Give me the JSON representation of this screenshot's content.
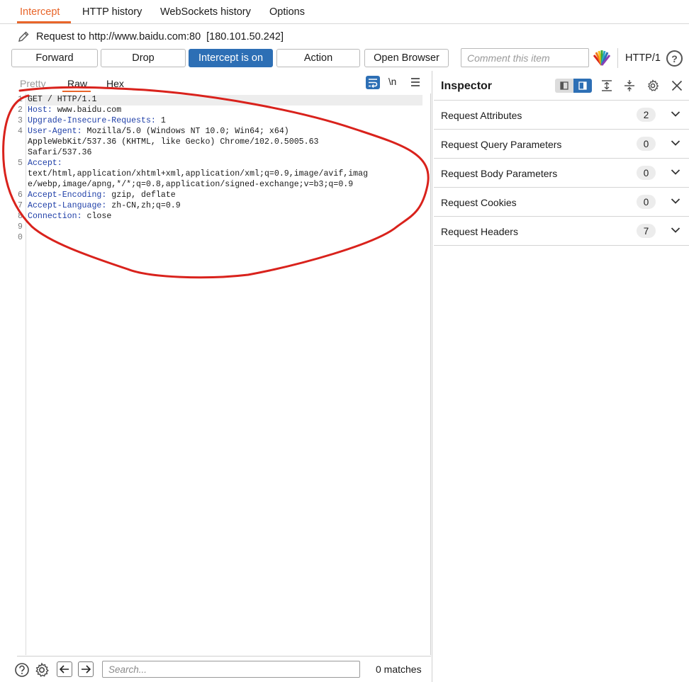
{
  "top_tabs": [
    {
      "label": "Intercept",
      "active": true
    },
    {
      "label": "HTTP history",
      "active": false
    },
    {
      "label": "WebSockets history",
      "active": false
    },
    {
      "label": "Options",
      "active": false
    }
  ],
  "request": {
    "label": "Request to http://www.baidu.com:80",
    "ip": "[180.101.50.242]"
  },
  "toolbar": {
    "forward": "Forward",
    "drop": "Drop",
    "intercept": "Intercept is on",
    "action": "Action",
    "open_browser": "Open Browser",
    "comment_placeholder": "Comment this item",
    "http_version": "HTTP/1",
    "help": "?"
  },
  "editor_tabs": {
    "pretty": "Pretty",
    "raw": "Raw",
    "hex": "Hex",
    "newline_toggle": "\\n"
  },
  "editor_lines": [
    {
      "num": "1",
      "key": "",
      "val": "GET / HTTP/1.1"
    },
    {
      "num": "2",
      "key": "Host:",
      "val": " www.baidu.com"
    },
    {
      "num": "3",
      "key": "Upgrade-Insecure-Requests:",
      "val": " 1"
    },
    {
      "num": "4",
      "key": "User-Agent:",
      "val": " Mozilla/5.0 (Windows NT 10.0; Win64; x64)"
    },
    {
      "num": "",
      "key": "",
      "val": "AppleWebKit/537.36 (KHTML, like Gecko) Chrome/102.0.5005.63"
    },
    {
      "num": "",
      "key": "",
      "val": "Safari/537.36"
    },
    {
      "num": "5",
      "key": "Accept:",
      "val": ""
    },
    {
      "num": "",
      "key": "",
      "val": "text/html,application/xhtml+xml,application/xml;q=0.9,image/avif,imag"
    },
    {
      "num": "",
      "key": "",
      "val": "e/webp,image/apng,*/*;q=0.8,application/signed-exchange;v=b3;q=0.9"
    },
    {
      "num": "6",
      "key": "Accept-Encoding:",
      "val": " gzip, deflate"
    },
    {
      "num": "7",
      "key": "Accept-Language:",
      "val": " zh-CN,zh;q=0.9"
    },
    {
      "num": "8",
      "key": "Connection:",
      "val": " close"
    },
    {
      "num": "9",
      "key": "",
      "val": ""
    },
    {
      "num": "0",
      "key": "",
      "val": ""
    }
  ],
  "search": {
    "placeholder": "Search...",
    "matches": "0 matches"
  },
  "inspector": {
    "title": "Inspector",
    "sections": [
      {
        "label": "Request Attributes",
        "count": "2"
      },
      {
        "label": "Request Query Parameters",
        "count": "0"
      },
      {
        "label": "Request Body Parameters",
        "count": "0"
      },
      {
        "label": "Request Cookies",
        "count": "0"
      },
      {
        "label": "Request Headers",
        "count": "7"
      }
    ]
  },
  "colors": {
    "accent": "#e8652a",
    "primary": "#2d6fb5",
    "header_key": "#1f3fa8",
    "annotation": "#d9221c"
  }
}
